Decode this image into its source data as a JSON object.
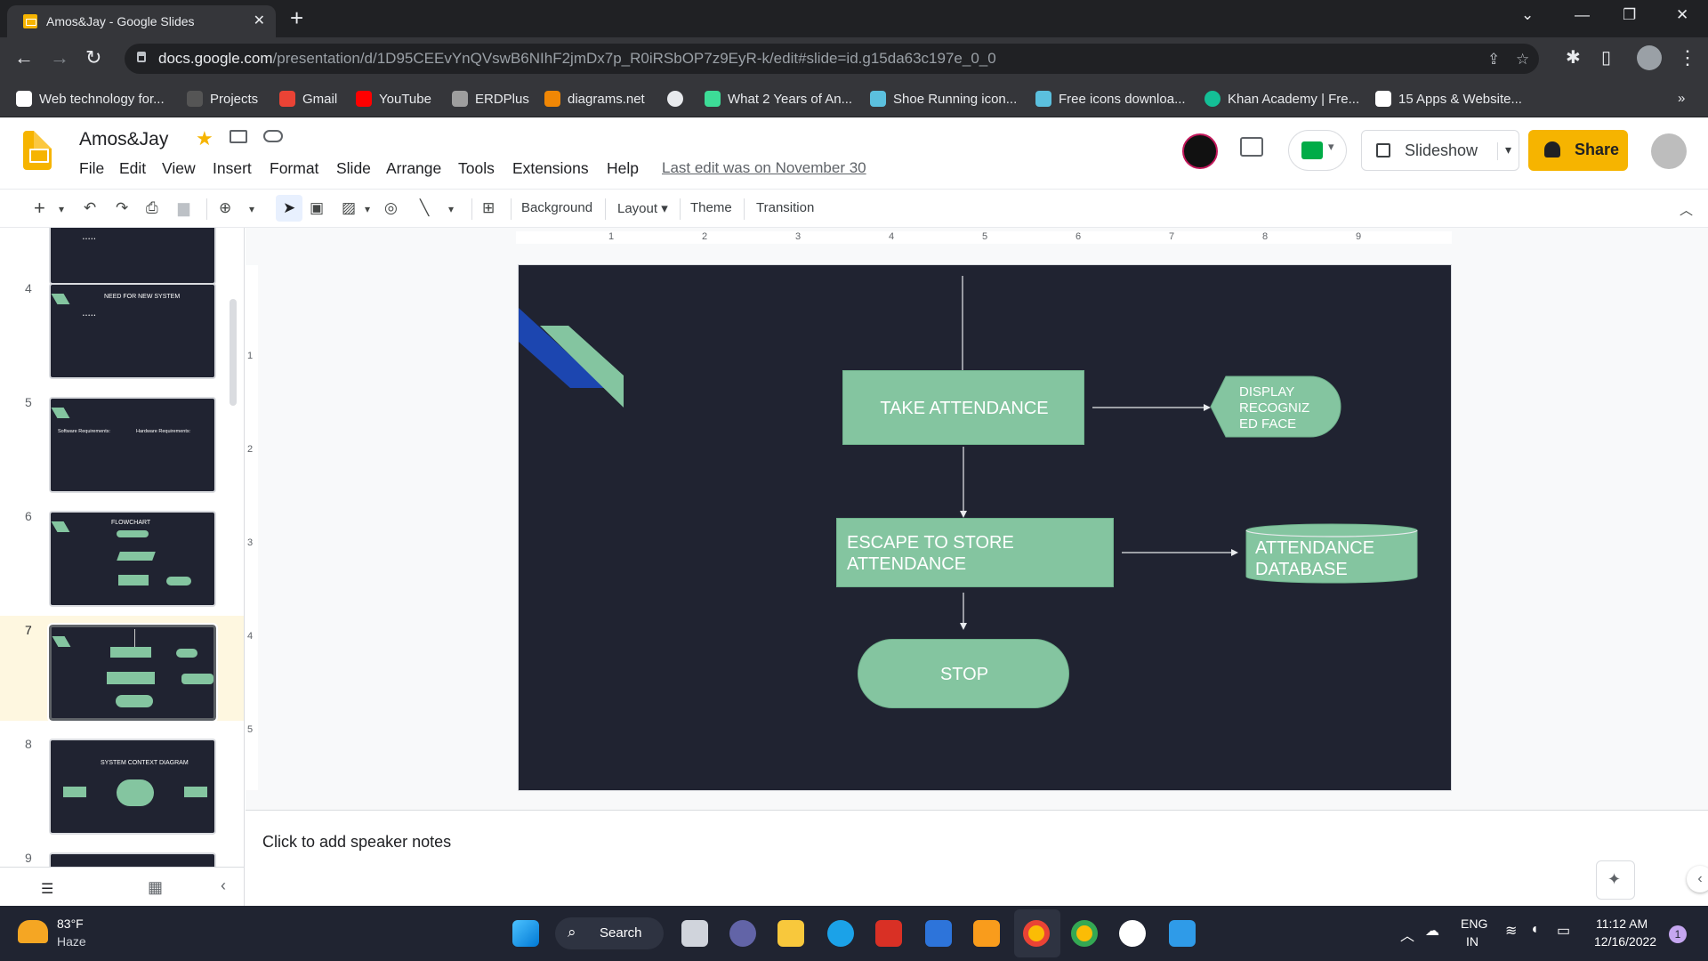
{
  "browser": {
    "tab_title": "Amos&Jay - Google Slides",
    "url_host": "docs.google.com",
    "url_path": "/presentation/d/1D95CEEvYnQVswB6NIhF2jmDx7p_R0iRSbOP7z9EyR-k/edit#slide=id.g15da63c197e_0_0"
  },
  "bookmarks": [
    "Web technology for...",
    "Projects",
    "Gmail",
    "YouTube",
    "ERDPlus",
    "diagrams.net",
    "",
    "What 2 Years of An...",
    "Shoe Running icon...",
    "Free icons downloa...",
    "Khan Academy | Fre...",
    "15 Apps & Website..."
  ],
  "app": {
    "doc_title": "Amos&Jay",
    "menus": [
      "File",
      "Edit",
      "View",
      "Insert",
      "Format",
      "Slide",
      "Arrange",
      "Tools",
      "Extensions",
      "Help"
    ],
    "last_edit": "Last edit was on November 30",
    "slideshow_label": "Slideshow",
    "share_label": "Share"
  },
  "toolbar": {
    "background": "Background",
    "layout": "Layout",
    "theme": "Theme",
    "transition": "Transition"
  },
  "ruler": {
    "h_ticks": [
      "1",
      "2",
      "3",
      "4",
      "5",
      "6",
      "7",
      "8",
      "9"
    ],
    "v_ticks": [
      "1",
      "2",
      "3",
      "4",
      "5"
    ]
  },
  "filmstrip": {
    "slide_numbers": [
      "4",
      "5",
      "6",
      "7",
      "8",
      "9"
    ],
    "s4_title": "NEED FOR NEW SYSTEM",
    "s5_left": "Software Requirements:",
    "s5_right": "Hardware Requirements:",
    "s6_title": "FLOWCHART",
    "s8_title": "SYSTEM CONTEXT DIAGRAM"
  },
  "slide": {
    "take_attendance": "TAKE ATTENDANCE",
    "display": "DISPLAY RECOGNIZ ED FACE",
    "escape": "ESCAPE TO STORE ATTENDANCE",
    "database": "ATTENDANCE DATABASE",
    "stop": "STOP"
  },
  "notes": {
    "placeholder": "Click to add speaker notes"
  },
  "taskbar": {
    "weather_temp": "83°F",
    "weather_desc": "Haze",
    "search": "Search",
    "lang1": "ENG",
    "lang2": "IN",
    "time": "11:12 AM",
    "date": "12/16/2022",
    "notif_count": "1"
  },
  "colors": {
    "shape_fill": "#84c5a0",
    "slide_bg": "#202331",
    "share": "#f6b400"
  }
}
